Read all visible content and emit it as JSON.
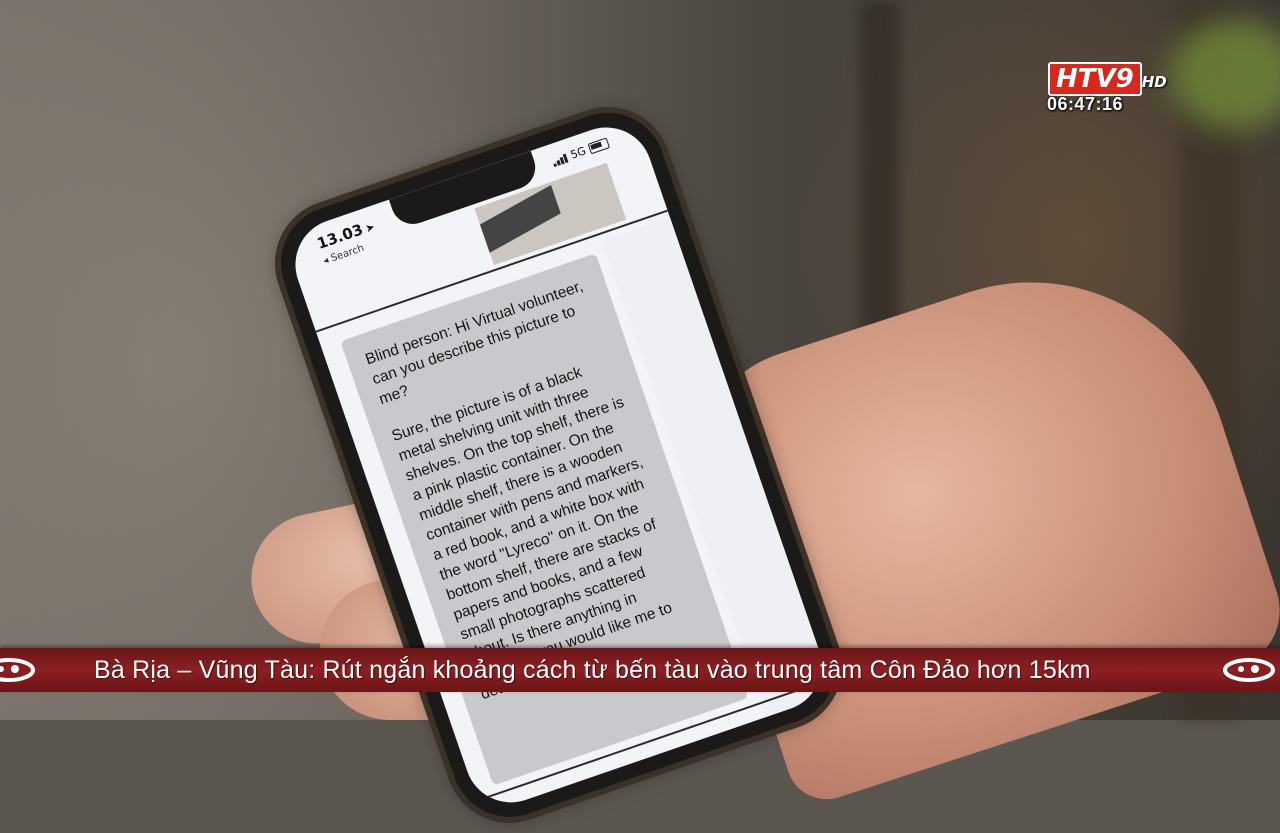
{
  "broadcast": {
    "channel_logo": "HTV9",
    "channel_logo_suffix": "HD",
    "clock": "06:47:16",
    "ticker_text": "Bà Rịa – Vũng Tàu: Rút ngắn khoảng cách từ bến tàu vào trung tâm Côn Đảo hơn 15km",
    "ticker_icon_left": "htv-swirl-icon",
    "ticker_icon_right": "htv-swirl-icon"
  },
  "phone": {
    "status_time": "13.03",
    "back_label": "◂ Search",
    "network": "5G",
    "chat": {
      "question": "Blind person: Hi Virtual volunteer, can you describe this picture to me?",
      "answer": "Sure, the picture is of a black metal shelving unit with three shelves. On the top shelf, there is a pink plastic container. On the middle shelf, there is a wooden container with pens and markers, a red book, and a white box with the word \"Lyreco\" on it. On the bottom shelf, there are stacks of papers and books, and a few small photographs scattered about. Is there anything in particular you would like me to detail?"
    }
  },
  "colors": {
    "ticker_bg": "#8c1f22",
    "logo_red": "#d8281c",
    "button_blue": "#1f63e0",
    "bubble_gray": "#c8c9cc"
  }
}
